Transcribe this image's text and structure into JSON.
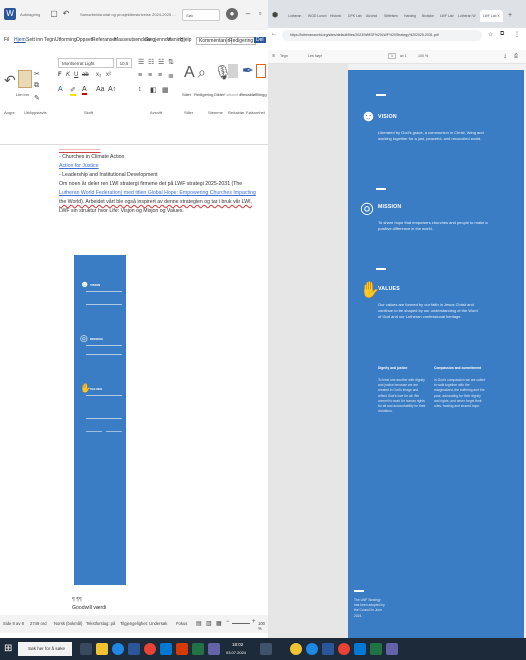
{
  "left": {
    "titlebar": {
      "autosave": "Autolagring",
      "doc_title": "Samarbeidsnotat og prosjektbeskrivelse 2024-2025 ...",
      "search_placeholder": "Søk"
    },
    "menu": [
      "Fil",
      "Hjem",
      "Sett inn",
      "Tegn",
      "Utforming",
      "Oppsett",
      "Referanser",
      "Masseutsendelse",
      "Se gjennom",
      "Visning",
      "Hjelp"
    ],
    "menu_right": {
      "comments": "Kommentarer",
      "editing": "Redigering",
      "share": "Del"
    },
    "ribbon": {
      "font_name": "Montserrat Light",
      "font_size": "10,5",
      "paste": "Lim inn",
      "groups": [
        "Angre",
        "Utklippstavle",
        "Skrift",
        "Avsnitt",
        "Stiler",
        "Stemme",
        "Redaktør",
        "Følsomhet",
        "Tillegg"
      ],
      "styles": "Stiler",
      "editing": "Redigering",
      "dictate": "Diktér",
      "sensitivity": "Følsomhet",
      "editor": "Redaktør",
      "addins": "Tillegg"
    },
    "doc_lines": [
      {
        "text": "- Churches in Climate Action",
        "style": ""
      },
      {
        "text": "Action for Justice",
        "style": "link"
      },
      {
        "text": "- Leadership and Institutional Development",
        "style": ""
      },
      {
        "text": "Om noen år deler ren LWI stratergi firmene det på LWF strategi 2025-2031 (The",
        "style": "link"
      },
      {
        "text": "Lutheran World Federation) med titlen Global Hope: Empowering Churches Impacting",
        "style": "link"
      },
      {
        "text": "the World). Arbeidet vårt ble også inspirert av denne strategien og tar i bruk vår LWI,",
        "style": ""
      },
      {
        "text": "LWF sin struktur hvor Life: Visjon og Misjon og Values.",
        "style": ""
      }
    ],
    "bottom_line": "Goodwill værdi",
    "status": {
      "page": "Side 8 av 8",
      "words": "2749 ord",
      "language": "Norsk (bokmål)",
      "predictions": "Tekstforslag: på",
      "accessibility": "Tilgjengelighet: Undersøk",
      "focus": "Fokus",
      "zoom": "100 %"
    }
  },
  "right": {
    "tabs": [
      "Lutheran",
      "WOD Lunch",
      "Historic",
      "DPK Lab",
      "Alcohol",
      "Stiftelsen",
      "Hardnig",
      "Bioticke",
      "LWF Lab",
      "Lutheran W",
      "LWF Lab X"
    ],
    "url": "https://lutheranworld.org/sites/default/files/2023/WMSF%20LWF%20Strategy%202025-2031.pdf",
    "pdf_toolbar": {
      "contents": "Tegn",
      "draw": "Les høyt",
      "page": "1",
      "of": "av 1",
      "zoom": "100 %"
    },
    "sections": [
      {
        "title": "VISION",
        "body": "Liberated by God's grace, a communion in Christ, living and working together for a just, peaceful, and reconciled world."
      },
      {
        "title": "MISSION",
        "body": "To share hope that empowers churches and people to make a positive difference in the world."
      },
      {
        "title": "VALUES",
        "body": "Our values are formed by our faith in Jesus Christ and continue to be shaped by our understanding of the Word of God and our Lutheran confessional heritage."
      }
    ],
    "columns": [
      {
        "title": "Dignity and justice",
        "body": "To treat one another with dignity and justice because we are created in God's image and reflect God's love for all. We commit to work for human rights for all and accountability for their violations."
      },
      {
        "title": "Compassion and commitment",
        "body": "In God's compassion we are called to walk together with the marginalized, the suffering and the poor, advocating for their dignity and rights, and never forget their cries, healing and shared hope."
      }
    ],
    "footer": "The LWF Strategy has been adopted by the Council in June 2024."
  },
  "taskbar": {
    "search_placeholder": "Søk her for å søke",
    "time": "18:02",
    "date": "03.07.2024"
  }
}
